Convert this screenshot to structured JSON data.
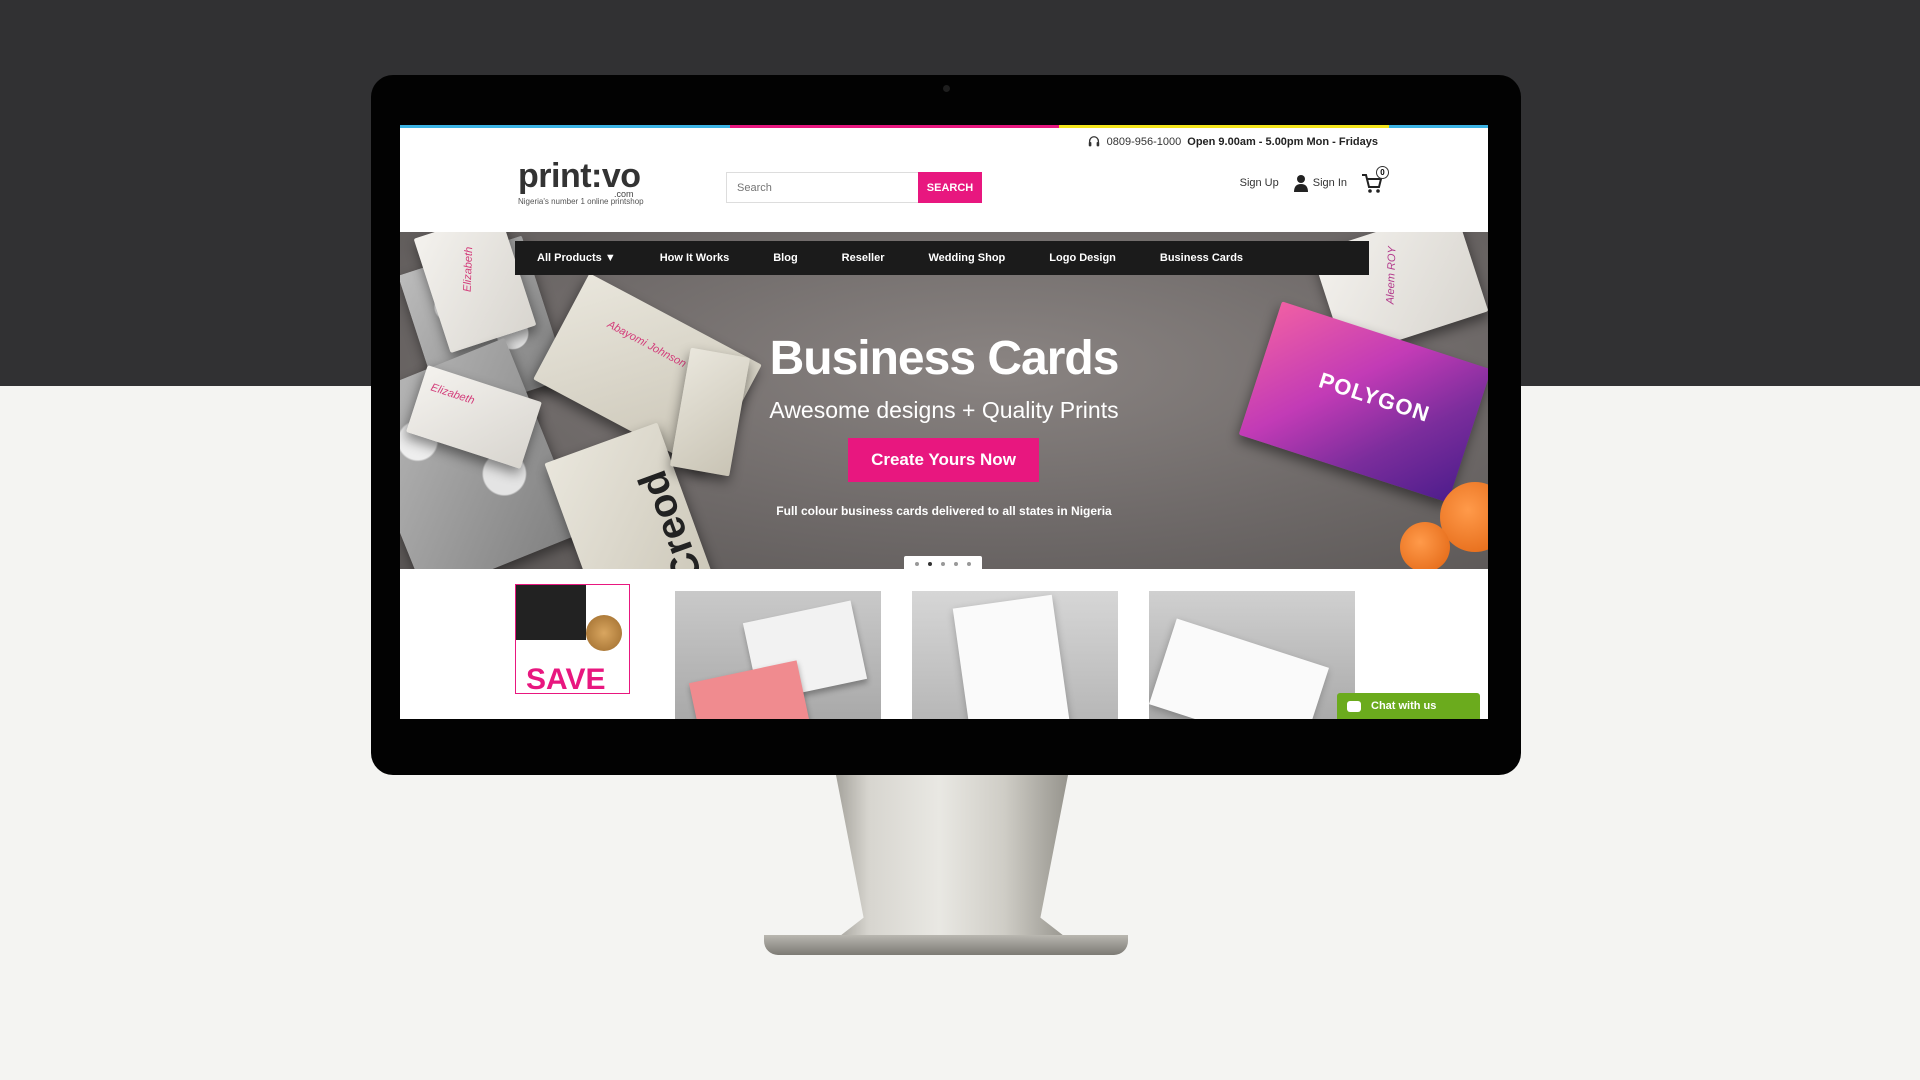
{
  "colors": {
    "brand_pink": "#e8177f",
    "chat_green": "#6bab1d",
    "strip": [
      "#3cb4e5",
      "#e8177f",
      "#f4e51c",
      "#3cb4e5"
    ]
  },
  "header": {
    "phone": "0809-956-1000",
    "hours": "Open 9.00am - 5.00pm Mon - Fridays",
    "logo_text": "print:vo",
    "logo_domain": ".com",
    "logo_tagline": "Nigeria's number 1 online printshop",
    "search_placeholder": "Search",
    "search_button": "SEARCH",
    "sign_up": "Sign Up",
    "sign_in": "Sign In",
    "cart_count": "0"
  },
  "nav": {
    "items": [
      "All Products ▼",
      "How It Works",
      "Blog",
      "Reseller",
      "Wedding Shop",
      "Logo Design",
      "Business Cards"
    ]
  },
  "hero": {
    "title": "Business Cards",
    "subtitle": "Awesome designs + Quality Prints",
    "cta": "Create Yours Now",
    "note": "Full colour business cards delivered to all states in Nigeria",
    "slides_total": 5,
    "active_slide": 2,
    "card_names": [
      "Elizabeth",
      "Abayomi Johnson",
      "Creod",
      "Aleem ROY",
      "POLYGON"
    ]
  },
  "products": {
    "save_label": "SAVE"
  },
  "chat": {
    "label": "Chat with us"
  }
}
